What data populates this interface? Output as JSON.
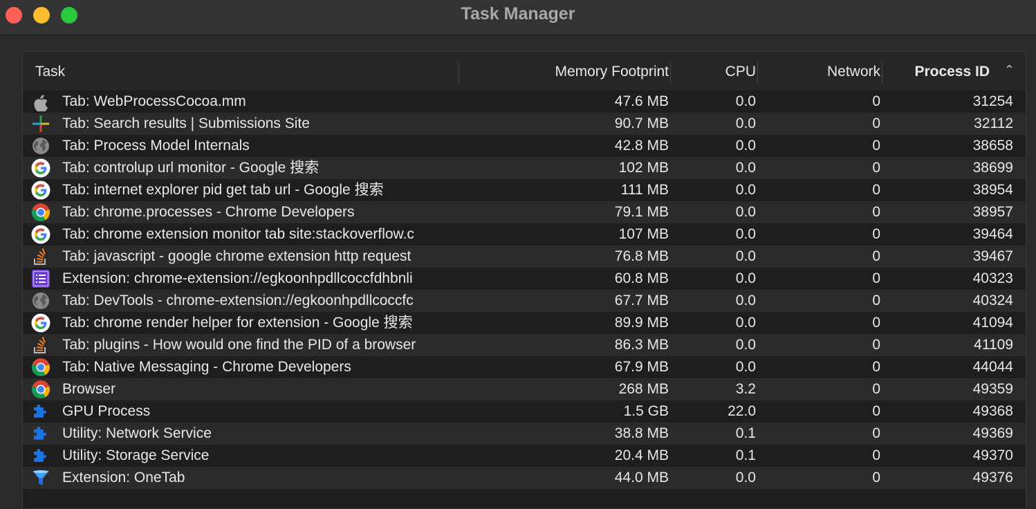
{
  "window": {
    "title": "Task Manager"
  },
  "columns": {
    "task": "Task",
    "memory": "Memory Footprint",
    "cpu": "CPU",
    "network": "Network",
    "pid": "Process ID"
  },
  "rows": [
    {
      "icon": "apple-icon",
      "task": "Tab: WebProcessCocoa.mm",
      "memory": "47.6 MB",
      "cpu": "0.0",
      "network": "0",
      "pid": "31254"
    },
    {
      "icon": "plus-colored-icon",
      "task": "Tab: Search results | Submissions Site",
      "memory": "90.7 MB",
      "cpu": "0.0",
      "network": "0",
      "pid": "32112"
    },
    {
      "icon": "globe-icon",
      "task": "Tab: Process Model Internals",
      "memory": "42.8 MB",
      "cpu": "0.0",
      "network": "0",
      "pid": "38658"
    },
    {
      "icon": "google-icon",
      "task": "Tab: controlup url monitor - Google 搜索",
      "memory": "102 MB",
      "cpu": "0.0",
      "network": "0",
      "pid": "38699"
    },
    {
      "icon": "google-icon",
      "task": "Tab: internet explorer pid get tab url - Google 搜索",
      "memory": "111 MB",
      "cpu": "0.0",
      "network": "0",
      "pid": "38954"
    },
    {
      "icon": "chrome-icon",
      "task": "Tab: chrome.processes - Chrome Developers",
      "memory": "79.1 MB",
      "cpu": "0.0",
      "network": "0",
      "pid": "38957"
    },
    {
      "icon": "google-icon",
      "task": "Tab: chrome extension monitor tab site:stackoverflow.c",
      "memory": "107 MB",
      "cpu": "0.0",
      "network": "0",
      "pid": "39464"
    },
    {
      "icon": "stackoverflow-icon",
      "task": "Tab: javascript - google chrome extension http request",
      "memory": "76.8 MB",
      "cpu": "0.0",
      "network": "0",
      "pid": "39467"
    },
    {
      "icon": "extension-list-icon",
      "task": "Extension: chrome-extension://egkoonhpdllcoccfdhbnli",
      "memory": "60.8 MB",
      "cpu": "0.0",
      "network": "0",
      "pid": "40323"
    },
    {
      "icon": "globe-icon",
      "task": "Tab: DevTools - chrome-extension://egkoonhpdllcoccfc",
      "memory": "67.7 MB",
      "cpu": "0.0",
      "network": "0",
      "pid": "40324"
    },
    {
      "icon": "google-icon",
      "task": "Tab: chrome render helper for extension - Google 搜索",
      "memory": "89.9 MB",
      "cpu": "0.0",
      "network": "0",
      "pid": "41094"
    },
    {
      "icon": "stackoverflow-icon",
      "task": "Tab: plugins - How would one find the PID of a browser",
      "memory": "86.3 MB",
      "cpu": "0.0",
      "network": "0",
      "pid": "41109"
    },
    {
      "icon": "chrome-icon",
      "task": "Tab: Native Messaging - Chrome Developers",
      "memory": "67.9 MB",
      "cpu": "0.0",
      "network": "0",
      "pid": "44044"
    },
    {
      "icon": "chrome-icon",
      "task": "Browser",
      "memory": "268 MB",
      "cpu": "3.2",
      "network": "0",
      "pid": "49359"
    },
    {
      "icon": "puzzle-icon",
      "task": "GPU Process",
      "memory": "1.5 GB",
      "cpu": "22.0",
      "network": "0",
      "pid": "49368"
    },
    {
      "icon": "puzzle-icon",
      "task": "Utility: Network Service",
      "memory": "38.8 MB",
      "cpu": "0.1",
      "network": "0",
      "pid": "49369"
    },
    {
      "icon": "puzzle-icon",
      "task": "Utility: Storage Service",
      "memory": "20.4 MB",
      "cpu": "0.1",
      "network": "0",
      "pid": "49370"
    },
    {
      "icon": "onetab-funnel-icon",
      "task": "Extension: OneTab",
      "memory": "44.0 MB",
      "cpu": "0.0",
      "network": "0",
      "pid": "49376"
    }
  ]
}
